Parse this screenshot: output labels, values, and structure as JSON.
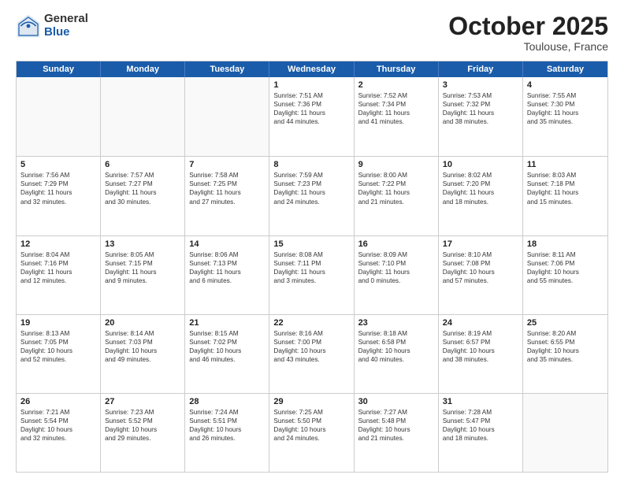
{
  "logo": {
    "general": "General",
    "blue": "Blue"
  },
  "header": {
    "month": "October 2025",
    "location": "Toulouse, France"
  },
  "weekdays": [
    "Sunday",
    "Monday",
    "Tuesday",
    "Wednesday",
    "Thursday",
    "Friday",
    "Saturday"
  ],
  "rows": [
    [
      {
        "day": "",
        "info": "",
        "empty": true
      },
      {
        "day": "",
        "info": "",
        "empty": true
      },
      {
        "day": "",
        "info": "",
        "empty": true
      },
      {
        "day": "1",
        "info": "Sunrise: 7:51 AM\nSunset: 7:36 PM\nDaylight: 11 hours\nand 44 minutes."
      },
      {
        "day": "2",
        "info": "Sunrise: 7:52 AM\nSunset: 7:34 PM\nDaylight: 11 hours\nand 41 minutes."
      },
      {
        "day": "3",
        "info": "Sunrise: 7:53 AM\nSunset: 7:32 PM\nDaylight: 11 hours\nand 38 minutes."
      },
      {
        "day": "4",
        "info": "Sunrise: 7:55 AM\nSunset: 7:30 PM\nDaylight: 11 hours\nand 35 minutes."
      }
    ],
    [
      {
        "day": "5",
        "info": "Sunrise: 7:56 AM\nSunset: 7:29 PM\nDaylight: 11 hours\nand 32 minutes."
      },
      {
        "day": "6",
        "info": "Sunrise: 7:57 AM\nSunset: 7:27 PM\nDaylight: 11 hours\nand 30 minutes."
      },
      {
        "day": "7",
        "info": "Sunrise: 7:58 AM\nSunset: 7:25 PM\nDaylight: 11 hours\nand 27 minutes."
      },
      {
        "day": "8",
        "info": "Sunrise: 7:59 AM\nSunset: 7:23 PM\nDaylight: 11 hours\nand 24 minutes."
      },
      {
        "day": "9",
        "info": "Sunrise: 8:00 AM\nSunset: 7:22 PM\nDaylight: 11 hours\nand 21 minutes."
      },
      {
        "day": "10",
        "info": "Sunrise: 8:02 AM\nSunset: 7:20 PM\nDaylight: 11 hours\nand 18 minutes."
      },
      {
        "day": "11",
        "info": "Sunrise: 8:03 AM\nSunset: 7:18 PM\nDaylight: 11 hours\nand 15 minutes."
      }
    ],
    [
      {
        "day": "12",
        "info": "Sunrise: 8:04 AM\nSunset: 7:16 PM\nDaylight: 11 hours\nand 12 minutes."
      },
      {
        "day": "13",
        "info": "Sunrise: 8:05 AM\nSunset: 7:15 PM\nDaylight: 11 hours\nand 9 minutes."
      },
      {
        "day": "14",
        "info": "Sunrise: 8:06 AM\nSunset: 7:13 PM\nDaylight: 11 hours\nand 6 minutes."
      },
      {
        "day": "15",
        "info": "Sunrise: 8:08 AM\nSunset: 7:11 PM\nDaylight: 11 hours\nand 3 minutes."
      },
      {
        "day": "16",
        "info": "Sunrise: 8:09 AM\nSunset: 7:10 PM\nDaylight: 11 hours\nand 0 minutes."
      },
      {
        "day": "17",
        "info": "Sunrise: 8:10 AM\nSunset: 7:08 PM\nDaylight: 10 hours\nand 57 minutes."
      },
      {
        "day": "18",
        "info": "Sunrise: 8:11 AM\nSunset: 7:06 PM\nDaylight: 10 hours\nand 55 minutes."
      }
    ],
    [
      {
        "day": "19",
        "info": "Sunrise: 8:13 AM\nSunset: 7:05 PM\nDaylight: 10 hours\nand 52 minutes."
      },
      {
        "day": "20",
        "info": "Sunrise: 8:14 AM\nSunset: 7:03 PM\nDaylight: 10 hours\nand 49 minutes."
      },
      {
        "day": "21",
        "info": "Sunrise: 8:15 AM\nSunset: 7:02 PM\nDaylight: 10 hours\nand 46 minutes."
      },
      {
        "day": "22",
        "info": "Sunrise: 8:16 AM\nSunset: 7:00 PM\nDaylight: 10 hours\nand 43 minutes."
      },
      {
        "day": "23",
        "info": "Sunrise: 8:18 AM\nSunset: 6:58 PM\nDaylight: 10 hours\nand 40 minutes."
      },
      {
        "day": "24",
        "info": "Sunrise: 8:19 AM\nSunset: 6:57 PM\nDaylight: 10 hours\nand 38 minutes."
      },
      {
        "day": "25",
        "info": "Sunrise: 8:20 AM\nSunset: 6:55 PM\nDaylight: 10 hours\nand 35 minutes."
      }
    ],
    [
      {
        "day": "26",
        "info": "Sunrise: 7:21 AM\nSunset: 5:54 PM\nDaylight: 10 hours\nand 32 minutes."
      },
      {
        "day": "27",
        "info": "Sunrise: 7:23 AM\nSunset: 5:52 PM\nDaylight: 10 hours\nand 29 minutes."
      },
      {
        "day": "28",
        "info": "Sunrise: 7:24 AM\nSunset: 5:51 PM\nDaylight: 10 hours\nand 26 minutes."
      },
      {
        "day": "29",
        "info": "Sunrise: 7:25 AM\nSunset: 5:50 PM\nDaylight: 10 hours\nand 24 minutes."
      },
      {
        "day": "30",
        "info": "Sunrise: 7:27 AM\nSunset: 5:48 PM\nDaylight: 10 hours\nand 21 minutes."
      },
      {
        "day": "31",
        "info": "Sunrise: 7:28 AM\nSunset: 5:47 PM\nDaylight: 10 hours\nand 18 minutes."
      },
      {
        "day": "",
        "info": "",
        "empty": true
      }
    ]
  ]
}
